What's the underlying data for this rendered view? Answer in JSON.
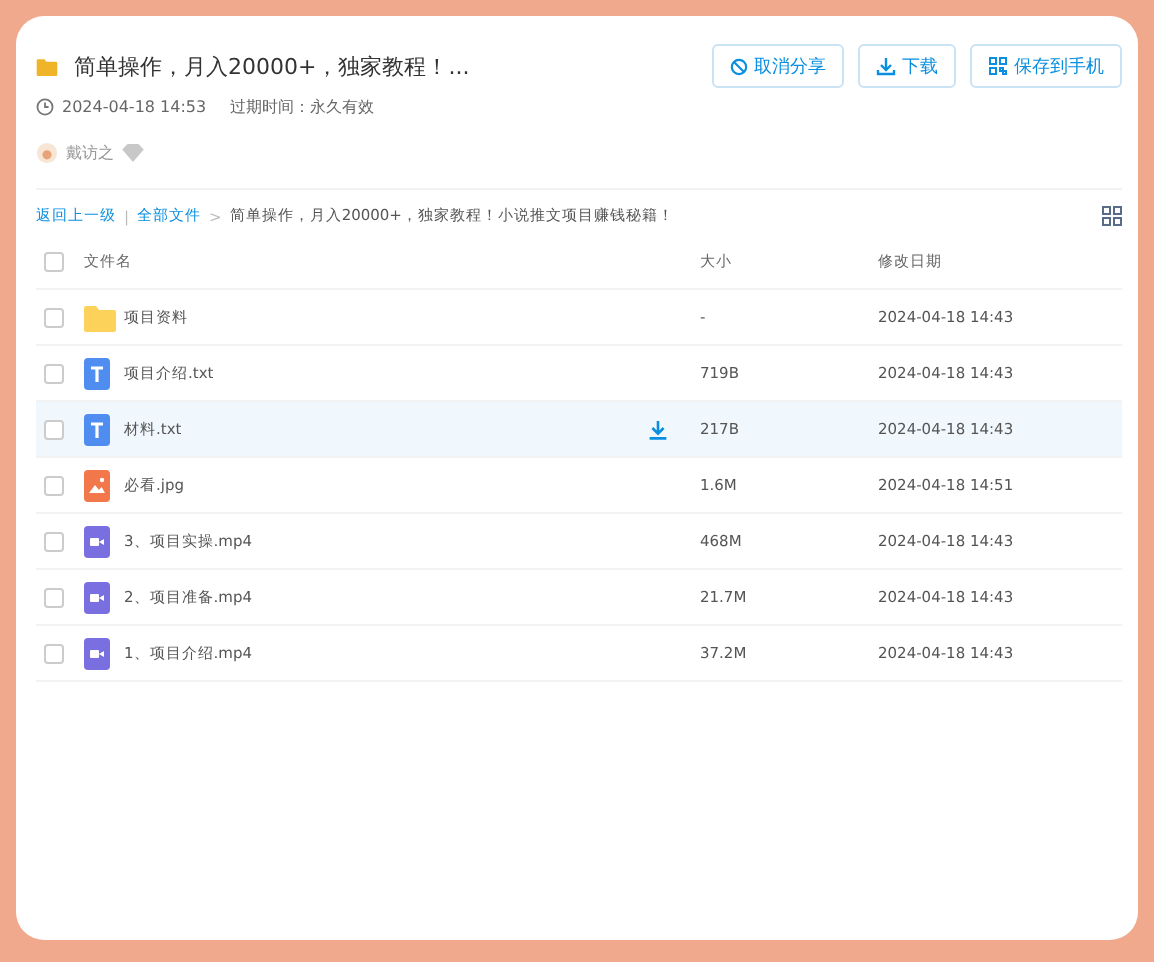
{
  "share": {
    "title": "简单操作，月入20000+，独家教程！...",
    "time": "2024-04-18 14:53",
    "expiry": "过期时间：永久有效",
    "user": "戴访之"
  },
  "actions": [
    {
      "kind": "cancel",
      "label": "取消分享"
    },
    {
      "kind": "download",
      "label": "下载"
    },
    {
      "kind": "phone",
      "label": "保存到手机"
    }
  ],
  "breadcrumb": {
    "back": "返回上一级",
    "root": "全部文件",
    "divider": "|",
    "separator": ">",
    "current": "简单操作，月入20000+，独家教程！小说推文项目赚钱秘籍！"
  },
  "table": {
    "select_all_checked": false,
    "columns": [
      "文件名",
      "大小",
      "修改日期"
    ],
    "rows": [
      {
        "kind": "folder",
        "name": "项目资料",
        "size": "-",
        "date": "2024-04-18 14:43",
        "highlighted": false
      },
      {
        "kind": "text",
        "name": "项目介绍.txt",
        "size": "719B",
        "date": "2024-04-18 14:43",
        "highlighted": false
      },
      {
        "kind": "text",
        "name": "材料.txt",
        "size": "217B",
        "date": "2024-04-18 14:43",
        "highlighted": true
      },
      {
        "kind": "image",
        "name": "必看.jpg",
        "size": "1.6M",
        "date": "2024-04-18 14:51",
        "highlighted": false
      },
      {
        "kind": "video",
        "name": "3、项目实操.mp4",
        "size": "468M",
        "date": "2024-04-18 14:43",
        "highlighted": false
      },
      {
        "kind": "video",
        "name": "2、项目准备.mp4",
        "size": "21.7M",
        "date": "2024-04-18 14:43",
        "highlighted": false
      },
      {
        "kind": "video",
        "name": "1、项目介绍.mp4",
        "size": "37.2M",
        "date": "2024-04-18 14:43",
        "highlighted": false
      }
    ]
  }
}
